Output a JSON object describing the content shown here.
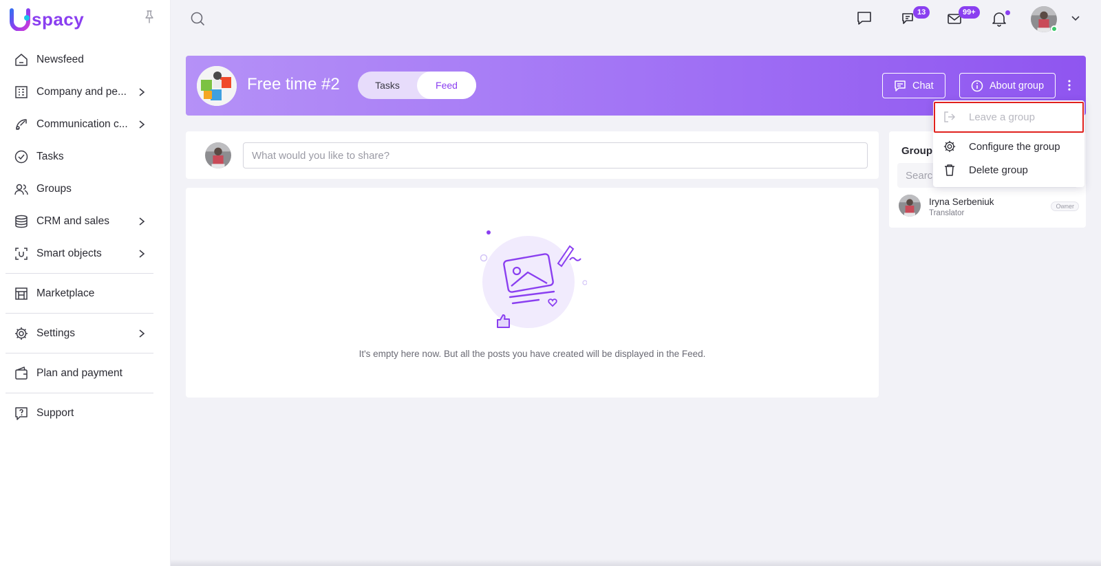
{
  "app": {
    "logo_text": "spacy"
  },
  "sidebar": {
    "items": [
      {
        "label": "Newsfeed",
        "icon": "home-icon",
        "has_chevron": false
      },
      {
        "label": "Company and pe...",
        "icon": "building-icon",
        "has_chevron": true
      },
      {
        "label": "Communication c...",
        "icon": "communication-icon",
        "has_chevron": true
      },
      {
        "label": "Tasks",
        "icon": "check-circle-icon",
        "has_chevron": false
      },
      {
        "label": "Groups",
        "icon": "users-icon",
        "has_chevron": false
      },
      {
        "label": "CRM and sales",
        "icon": "database-icon",
        "has_chevron": true
      },
      {
        "label": "Smart objects",
        "icon": "scan-icon",
        "has_chevron": true
      },
      {
        "label": "Marketplace",
        "icon": "store-icon",
        "has_chevron": false
      },
      {
        "label": "Settings",
        "icon": "gear-icon",
        "has_chevron": true
      },
      {
        "label": "Plan and payment",
        "icon": "wallet-icon",
        "has_chevron": false
      },
      {
        "label": "Support",
        "icon": "help-icon",
        "has_chevron": false
      }
    ]
  },
  "topbar": {
    "chats_badge": "13",
    "mail_badge": "99+"
  },
  "group": {
    "title": "Free time #2",
    "tabs": [
      {
        "label": "Tasks",
        "active": false
      },
      {
        "label": "Feed",
        "active": true
      }
    ],
    "chat_button": "Chat",
    "about_button": "About group"
  },
  "composer": {
    "placeholder": "What would you like to share?"
  },
  "feed": {
    "empty_text": "It's empty here now. But all the posts you have created will be displayed in the Feed."
  },
  "members": {
    "title": "Group",
    "search_placeholder": "Search",
    "list": [
      {
        "name": "Iryna Serbeniuk",
        "role": "Translator",
        "tag": "Owner"
      }
    ]
  },
  "menu": {
    "items": [
      {
        "label": "Leave a group",
        "icon": "logout-icon",
        "disabled": true,
        "highlighted": true
      },
      {
        "label": "Configure the group",
        "icon": "gear-icon",
        "disabled": false
      },
      {
        "label": "Delete group",
        "icon": "trash-icon",
        "disabled": false
      }
    ]
  },
  "colors": {
    "accent": "#8a3ff0",
    "highlight": "#e0211d",
    "online": "#3cc76a"
  }
}
